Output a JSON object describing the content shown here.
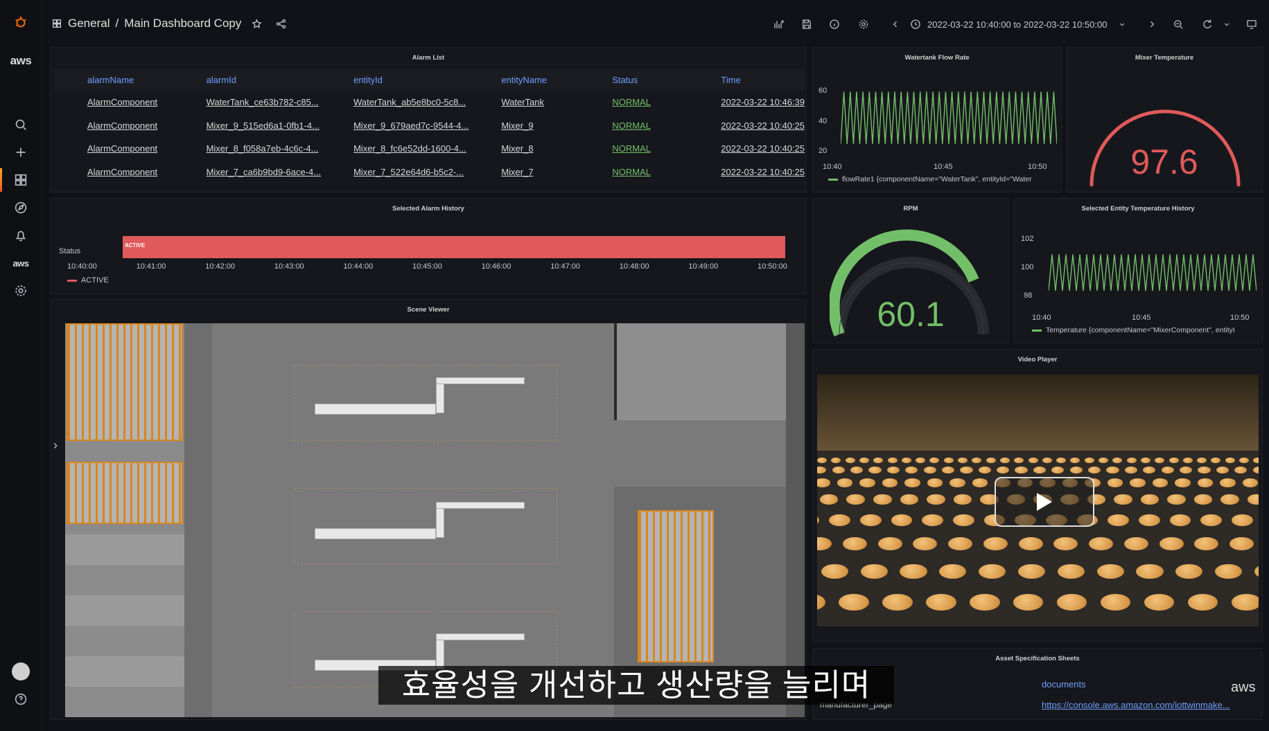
{
  "topbar": {
    "breadcrumb_folder": "General",
    "breadcrumb_sep": "/",
    "dashboard_title": "Main Dashboard Copy",
    "time_range": "2022-03-22 10:40:00 to 2022-03-22 10:50:00"
  },
  "sidebar": {
    "aws_label": "aws",
    "aws_label_small": "aws"
  },
  "alarm_list": {
    "title": "Alarm List",
    "columns": [
      "alarmName",
      "alarmId",
      "entityId",
      "entityName",
      "Status",
      "Time"
    ],
    "rows": [
      [
        "AlarmComponent",
        "WaterTank_ce63b782-c85...",
        "WaterTank_ab5e8bc0-5c8...",
        "WaterTank",
        "NORMAL",
        "2022-03-22 10:46:39"
      ],
      [
        "AlarmComponent",
        "Mixer_9_515ed6a1-0fb1-4...",
        "Mixer_9_679aed7c-9544-4...",
        "Mixer_9",
        "NORMAL",
        "2022-03-22 10:40:25"
      ],
      [
        "AlarmComponent",
        "Mixer_8_f058a7eb-4c6c-4...",
        "Mixer_8_fc6e52dd-1600-4...",
        "Mixer_8",
        "NORMAL",
        "2022-03-22 10:40:25"
      ],
      [
        "AlarmComponent",
        "Mixer_7_ca6b9bd9-6ace-4...",
        "Mixer_7_522e64d6-b5c2-...",
        "Mixer_7",
        "NORMAL",
        "2022-03-22 10:40:25"
      ]
    ]
  },
  "watertank": {
    "title": "Watertank Flow Rate",
    "y_ticks": [
      "60",
      "40",
      "20"
    ],
    "x_ticks": [
      "10:40",
      "10:45",
      "10:50"
    ],
    "legend": "flowRate1 {componentName=\"WaterTank\", entityId=\"Water"
  },
  "mixer_temp": {
    "title": "Mixer Temperature",
    "value": "97.6"
  },
  "alarm_history": {
    "title": "Selected Alarm History",
    "row_label": "Status",
    "bar_label": "ACTIVE",
    "x_ticks": [
      "10:40:00",
      "10:41:00",
      "10:42:00",
      "10:43:00",
      "10:44:00",
      "10:45:00",
      "10:46:00",
      "10:47:00",
      "10:48:00",
      "10:49:00",
      "10:50:00"
    ],
    "legend": "ACTIVE"
  },
  "rpm": {
    "title": "RPM",
    "value": "60.1"
  },
  "temp_history": {
    "title": "Selected Entity Temperature History",
    "y_ticks": [
      "102",
      "100",
      "98"
    ],
    "x_ticks": [
      "10:40",
      "10:45",
      "10:50"
    ],
    "legend": "Temperature {componentName=\"MixerComponent\", entityI"
  },
  "scene_viewer": {
    "title": "Scene Viewer"
  },
  "video_player": {
    "title": "Video Player"
  },
  "asset_sheets": {
    "title": "Asset Specification Sheets",
    "documents_header": "documents",
    "row_label": "manufacturer_page",
    "link": "https://console.aws.amazon.com/iottwinmake..."
  },
  "subtitle": "효율성을 개선하고 생산량을 늘리며",
  "watermark": "aws",
  "colors": {
    "accent_red": "#e05a5a",
    "accent_green": "#73bf69",
    "link_blue": "#6e9fff"
  },
  "chart_data": [
    {
      "type": "line",
      "title": "Watertank Flow Rate",
      "x": [
        "10:40",
        "10:45",
        "10:50"
      ],
      "ylim": [
        15,
        65
      ],
      "series": [
        {
          "name": "flowRate1 {componentName=\"WaterTank\", entityId=\"Water",
          "pattern": "oscillating",
          "min": 20,
          "max": 62
        }
      ]
    },
    {
      "type": "line",
      "title": "Selected Entity Temperature History",
      "x": [
        "10:40",
        "10:45",
        "10:50"
      ],
      "ylim": [
        97,
        103
      ],
      "series": [
        {
          "name": "Temperature {componentName=\"MixerComponent\", entityI",
          "pattern": "oscillating",
          "min": 98,
          "max": 101.5
        }
      ]
    }
  ]
}
